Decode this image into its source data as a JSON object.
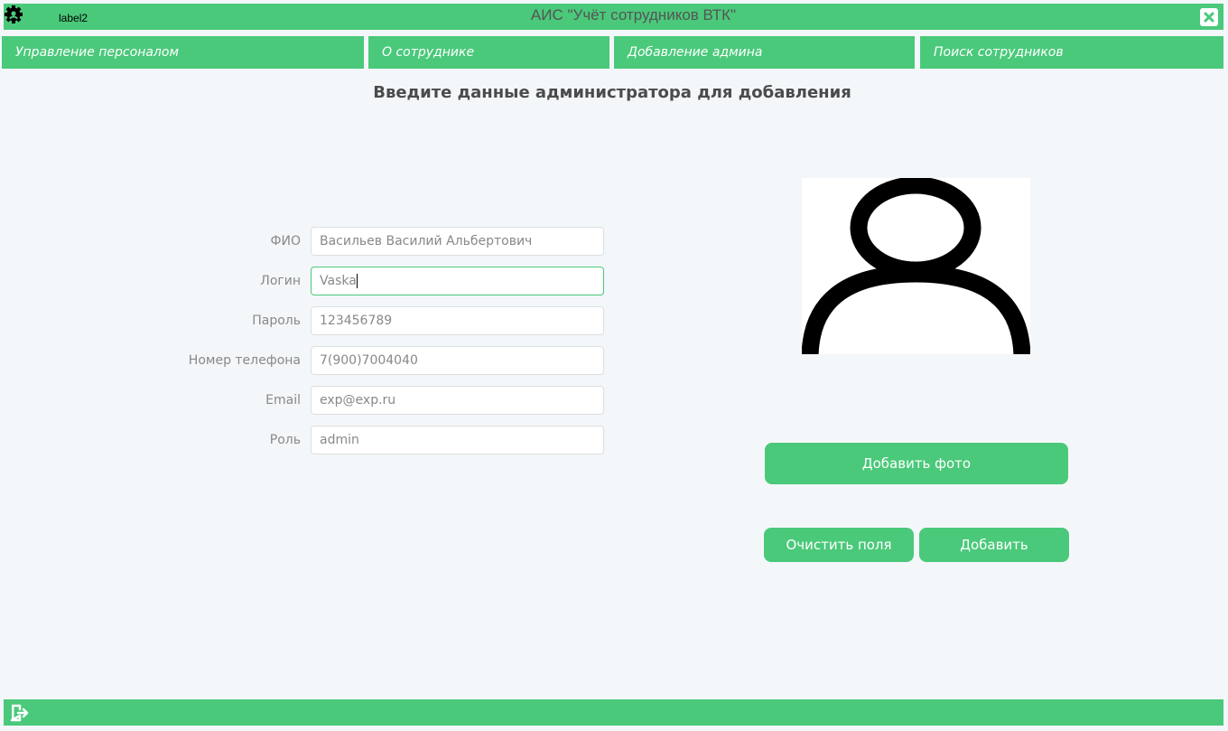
{
  "window": {
    "title": "АИС \"Учёт сотрудников ВТК\"",
    "label": "label2",
    "app_icon": "gear-icon",
    "close_icon": "close-icon"
  },
  "nav": {
    "items": [
      "Управление персоналом",
      "О сотруднике",
      "Добавление админа",
      "Поиск сотрудников"
    ]
  },
  "form": {
    "heading": "Введите данные администратора для добавления",
    "fields": [
      {
        "label": "ФИО",
        "value": "Васильев Василий Альбертович"
      },
      {
        "label": "Логин",
        "value": "Vaska"
      },
      {
        "label": "Пароль",
        "value": "123456789"
      },
      {
        "label": "Номер телефона",
        "value": "7(900)7004040"
      },
      {
        "label": "Email",
        "value": "exp@exp.ru"
      },
      {
        "label": "Роль",
        "value": "admin"
      }
    ]
  },
  "photo": {
    "icon": "user-avatar-icon",
    "add_label": "Добавить фото"
  },
  "actions": {
    "clear_label": "Очистить поля",
    "add_label": "Добавить"
  },
  "footer": {
    "icon": "logout-icon"
  },
  "colors": {
    "accent": "#4ac97a",
    "background": "#f3f7fa",
    "text_muted": "#888888"
  }
}
